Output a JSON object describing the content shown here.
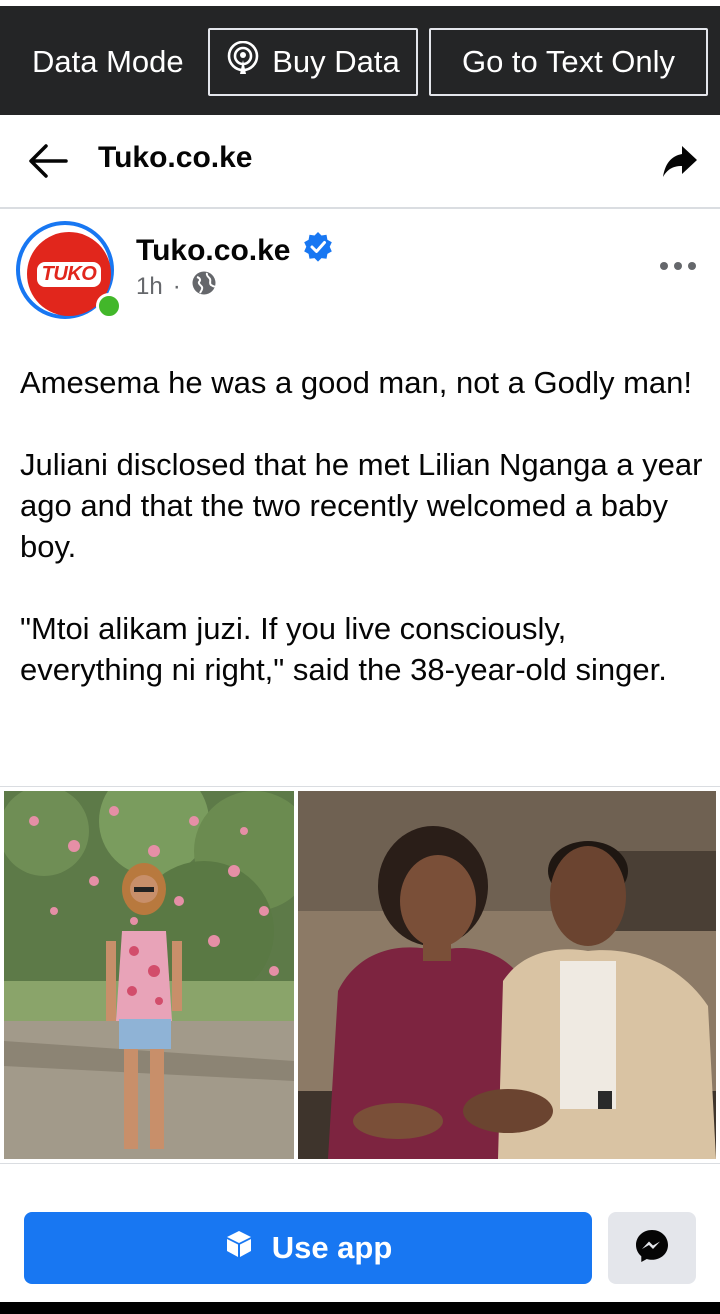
{
  "databar": {
    "mode_label": "Data Mode",
    "buy_data_label": "Buy Data",
    "text_only_label": "Go to Text Only"
  },
  "header": {
    "title": "Tuko.co.ke",
    "back_icon": "arrow-left-icon",
    "share_icon": "share-arrow-icon"
  },
  "post": {
    "page_name": "Tuko.co.ke",
    "logo_text": "TUKO",
    "verified_icon": "verified-badge-icon",
    "time": "1h",
    "separator": "·",
    "privacy_icon": "globe-icon",
    "more_icon": "more-dots-icon",
    "paragraphs": [
      "Amesema he was a good man, not a Godly man!",
      "Juliani disclosed that he met Lilian Nganga a year ago and that the two recently welcomed a baby boy.",
      "\"Mtoi alikam juzi. If you live consciously, everything ni right,\" said the 38-year-old singer."
    ]
  },
  "footer": {
    "use_app_label": "Use app",
    "messenger_icon": "messenger-icon"
  },
  "colors": {
    "accent": "#1877f2",
    "brand_red": "#e1261c",
    "online": "#42b72a",
    "dark_bar": "#242526"
  }
}
